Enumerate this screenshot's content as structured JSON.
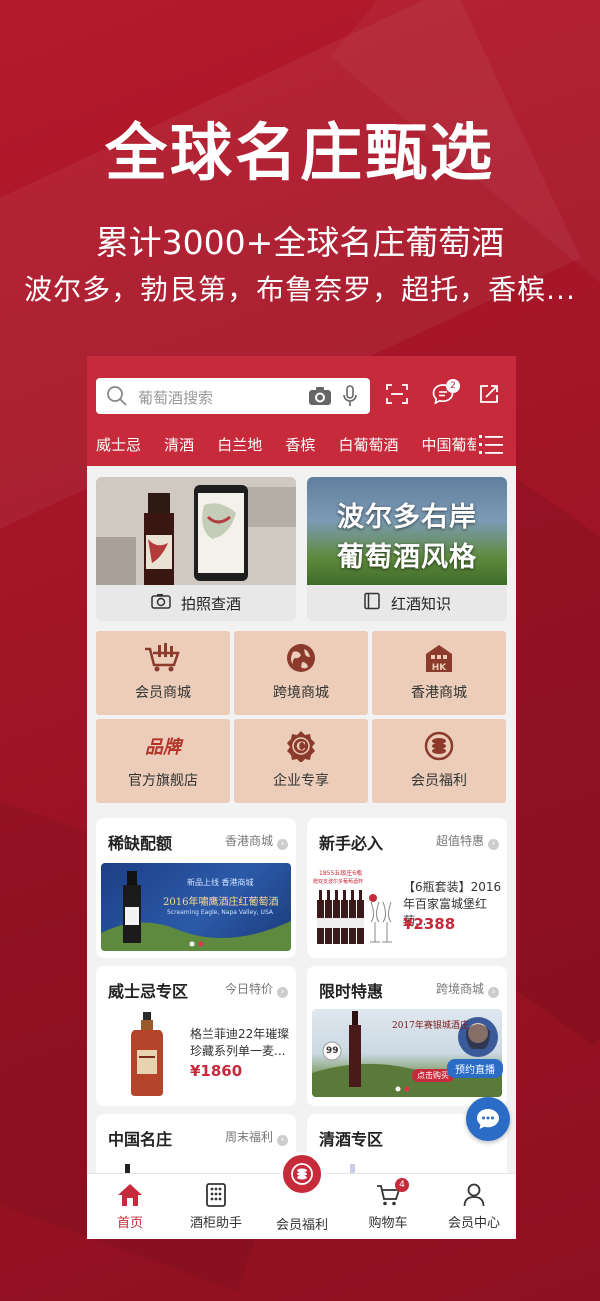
{
  "hero": {
    "title": "全球名庄甄选",
    "subtitle": "累计3000+全球名庄葡萄酒",
    "regions": "波尔多，勃艮第，布鲁奈罗，超托，香槟..."
  },
  "colors": {
    "brand": "#c72a3a",
    "background": "#9d1324",
    "tile": "#ebcdb9",
    "price": "#c72a3a",
    "chat": "#2a6cc6"
  },
  "search": {
    "placeholder": "葡萄酒搜索",
    "message_count": "2"
  },
  "categories": [
    "威士忌",
    "清酒",
    "白兰地",
    "香槟",
    "白葡萄酒",
    "中国葡萄酒"
  ],
  "banners": [
    {
      "label": "拍照查酒",
      "icon": "camera-icon"
    },
    {
      "label": "红酒知识",
      "icon": "book-icon",
      "image_text_1": "波尔多右岸",
      "image_text_2": "葡萄酒风格"
    }
  ],
  "tiles": [
    {
      "label": "会员商城",
      "icon": "cart-bottles-icon"
    },
    {
      "label": "跨境商城",
      "icon": "globe-icon"
    },
    {
      "label": "香港商城",
      "icon": "hk-building-icon",
      "icon_text": "HK"
    },
    {
      "label": "官方旗舰店",
      "icon": "brand-icon",
      "icon_text": "品牌"
    },
    {
      "label": "企业专享",
      "icon": "enterprise-badge-icon",
      "icon_text": "C"
    },
    {
      "label": "会员福利",
      "icon": "coins-icon"
    }
  ],
  "sections": [
    {
      "title": "稀缺配额",
      "tag": "香港商城",
      "banner_tag": "新品上线 香港商城",
      "banner_title": "2016年嘯鹰酒庄红葡萄酒",
      "banner_sub": "Screaming Eagle, Napa Valley, USA"
    },
    {
      "title": "新手必入",
      "tag": "超值特惠",
      "promo_1": "1855五级庄6瓶",
      "promo_2": "赠双支波尔多葡萄酒杯",
      "product": "【6瓶套装】2016年百家富城堡红葡...",
      "price": "¥2388"
    },
    {
      "title": "威士忌专区",
      "tag": "今日特价",
      "product": "格兰菲迪22年璀璨珍藏系列单一麦...",
      "price": "¥1860"
    },
    {
      "title": "限时特惠",
      "tag": "跨境商城",
      "banner_title": "2017年赛银城酒庄",
      "score": "99",
      "cta": "点击购买",
      "live": "预约直播"
    },
    {
      "title": "中国名庄",
      "tag": "周末福利"
    },
    {
      "title": "清酒专区",
      "tag": ""
    }
  ],
  "tabbar": [
    {
      "label": "首页",
      "icon": "home-icon"
    },
    {
      "label": "酒柜助手",
      "icon": "wine-cabinet-icon"
    },
    {
      "label": "会员福利",
      "icon": "coins-icon"
    },
    {
      "label": "购物车",
      "icon": "cart-icon",
      "badge": "4"
    },
    {
      "label": "会员中心",
      "icon": "user-icon"
    }
  ]
}
